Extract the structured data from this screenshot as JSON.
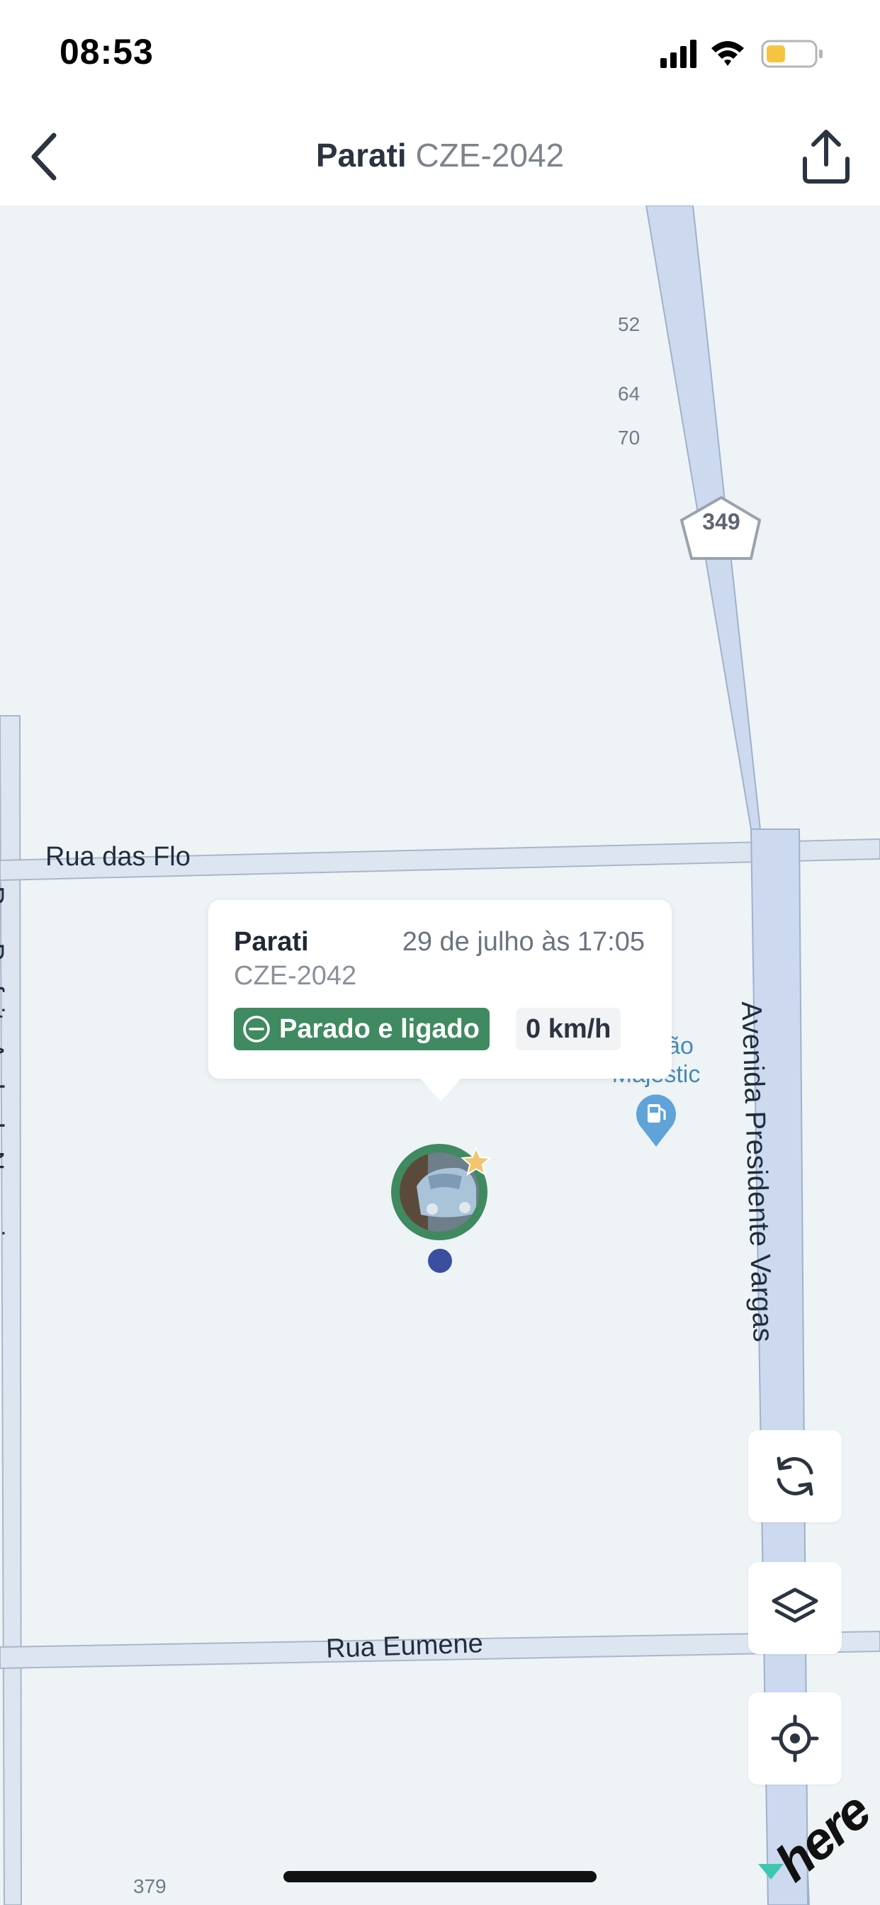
{
  "status_bar": {
    "time": "08:53",
    "icons": [
      "signal-icon",
      "wifi-icon",
      "battery-icon"
    ],
    "battery_color": "#f5c542"
  },
  "nav": {
    "title_name": "Parati",
    "title_plate": "CZE-2042",
    "back_icon": "chevron-left-icon",
    "share_icon": "share-icon"
  },
  "map": {
    "streets": {
      "rua_das_flores": "Rua das Flo",
      "rua_prefeito": "Rua Prefeito Andrade Nogueira",
      "rua_eumene": "Rua Eumene",
      "avenida": "Avenida Presidente Vargas"
    },
    "highway_shield": "349",
    "house_numbers": {
      "n52": "52",
      "n64": "64",
      "n70": "70",
      "n379": "379"
    },
    "poi": {
      "name_line1": "Postão",
      "name_line2": "Majestic",
      "icon": "gas-station-icon"
    },
    "provider": "here"
  },
  "popup": {
    "vehicle_name": "Parati",
    "datetime": "29 de julho às 17:05",
    "plate": "CZE-2042",
    "status": "Parado e ligado",
    "speed": "0 km/h",
    "status_color": "#3f8a60"
  },
  "controls": {
    "refresh_icon": "refresh-icon",
    "layers_icon": "layers-icon",
    "locate_icon": "crosshair-icon"
  }
}
